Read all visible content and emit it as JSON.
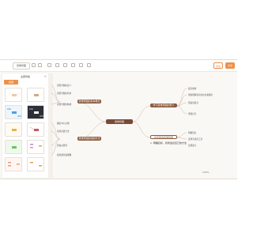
{
  "toolbar": {
    "title": "思维导图",
    "btn_left": "导出",
    "btn_right": "分享"
  },
  "panel": {
    "title": "主题风格",
    "close": "×",
    "tabs": [
      "经典",
      "",
      ""
    ]
  },
  "mindmap": {
    "root": "思维导图",
    "left_nodes": [
      "思维导图的基本概念",
      "思维导图的绘制方法"
    ],
    "right_nodes": [
      "学习思维导图的意义",
      "如何使用思维导图"
    ],
    "left_leaves_top": [
      "思维导图的定义",
      "思维导图的作用",
      "思维导图的构成"
    ],
    "left_leaves_bottom": [
      "确定中心主题",
      "绘制主要分支",
      "添加关键词",
      "使用颜色和图像"
    ],
    "right_leaves_top": [
      "提高效率",
      "帮助理解复杂的信息和概念",
      "激发创造力",
      "增强记忆"
    ],
    "right_leaves_bottom": [
      "明确目标",
      "选择合适的工具",
      "定期复习"
    ],
    "note": "1. 明确目标，找到适合自己的方法"
  },
  "zoom": "100%"
}
